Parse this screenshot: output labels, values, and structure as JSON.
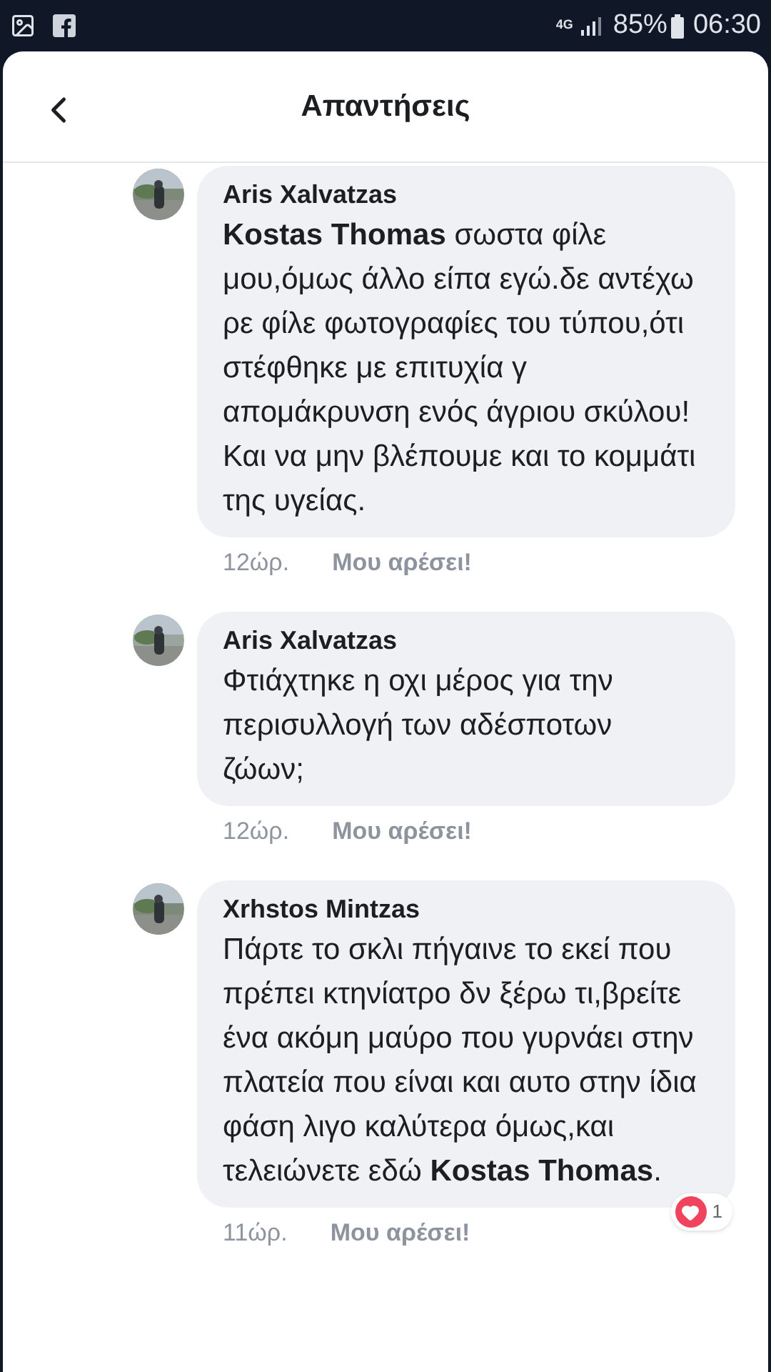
{
  "status_bar": {
    "network": "4G",
    "battery": "85%",
    "time": "06:30"
  },
  "header": {
    "title": "Απαντήσεις"
  },
  "comments": [
    {
      "author": "Aris Xalvatzas",
      "text": "**Kostas Thomas** σωστα φίλε μου,όμως άλλο είπα εγώ.δε αντέχω ρε φίλε φωτογραφίες του τύπου,ότι στέφθηκε με επιτυχία γ απομάκρυνση ενός άγριου σκύλου!Και να μην βλέπουμε και το κομμάτι της υγείας.",
      "time": "12ώρ.",
      "like": "Μου αρέσει!"
    },
    {
      "author": "Aris Xalvatzas",
      "text": "Φτιάχτηκε η οχι μέρος για την περισυλλογή των αδέσποτων ζώων;",
      "time": "12ώρ.",
      "like": "Μου αρέσει!"
    },
    {
      "author": "Xrhstos Mintzas",
      "text": "Πάρτε το σκλι πήγαινε το εκεί που πρέπει κτηνίατρο δν ξέρω τι,βρείτε ένα ακόμη μαύρο που γυρνάει στην πλατεία που είναι και αυτο στην ίδια φάση λιγο καλύτερα όμως,και τελειώνετε εδώ **Kostas Thomas**.",
      "time": "11ώρ.",
      "like": "Μου αρέσει!",
      "reaction": {
        "count": "1"
      }
    }
  ]
}
